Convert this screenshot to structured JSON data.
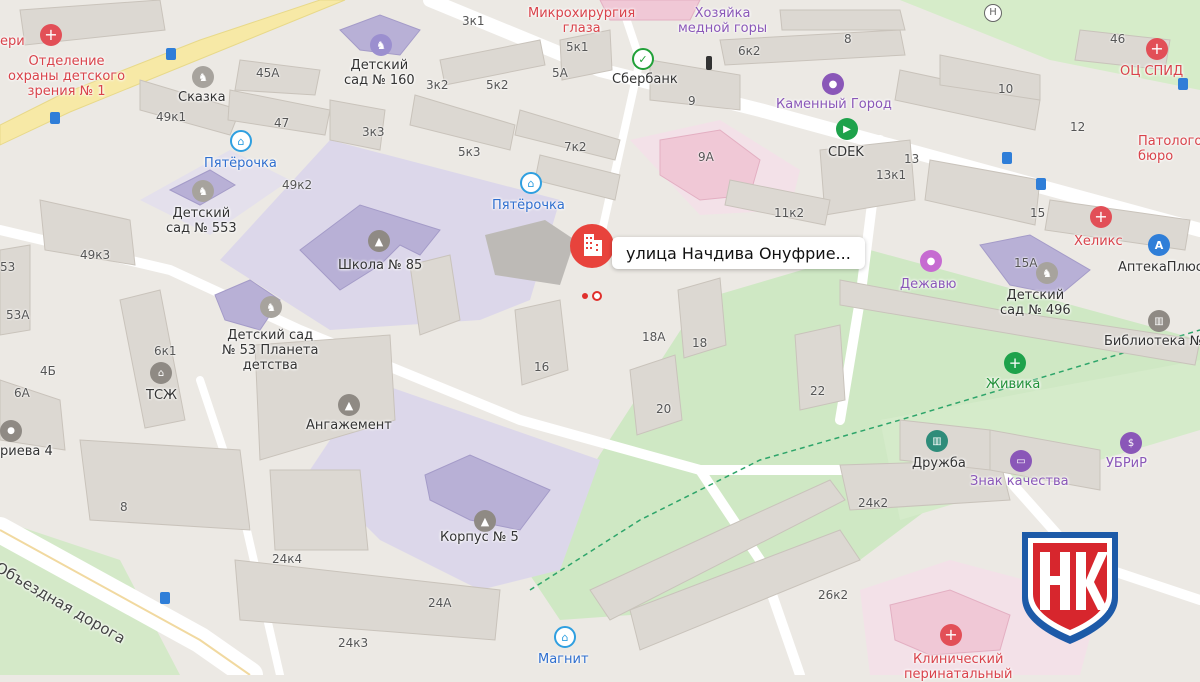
{
  "map": {
    "address_card": "улица Начдива Онуфрие...",
    "roads": [
      "Объездная дорога"
    ],
    "places": {
      "mikro": "Микрохирургия\nглаза",
      "hozyaika": "Хозяйка\nмедной горы",
      "otdelenie": "Отделение\nохраны детского\nзрения № 1",
      "eri": "ери",
      "sad160": "Детский\nсад № 160",
      "sberbank": "Сбербанк",
      "skazka": "Сказка",
      "pyat1": "Пятёрочка",
      "pyat2": "Пятёрочка",
      "kamenny": "Каменный Город",
      "cdek": "CDEK",
      "oc_spid": "ОЦ СПИД",
      "patolog": "Патологоанато\nбюро",
      "sad553": "Детский\nсад № 553",
      "school85": "Школа № 85",
      "helix": "Хеликс",
      "apteka": "АптекаПлюс",
      "dejavu": "Дежавю",
      "sad496": "Детский\nсад № 496",
      "sad53": "Детский сад\n№ 53 Планета\nдетства",
      "biblioteka": "Библиотека №",
      "zhivika": "Живика",
      "tszh": "ТСЖ",
      "angazhement": "Ангажемент",
      "druzhba": "Дружба",
      "ubrir": "УБРиР",
      "znak": "Знак качества",
      "orieva": "риева 4",
      "korpus5": "Корпус № 5",
      "magnit": "Магнит",
      "klinich": "Клинический\nперинатальный"
    },
    "house_numbers": {
      "n3k1": "3к1",
      "n5k1": "5к1",
      "n6k2": "6к2",
      "n8": "8",
      "n46": "46",
      "n45A": "45А",
      "n5A": "5А",
      "n3k2": "3к2",
      "n5k2": "5к2",
      "n9": "9",
      "n10": "10",
      "n49k1": "49к1",
      "n47": "47",
      "n3k3": "3к3",
      "n7k2": "7к2",
      "n9A": "9А",
      "n12": "12",
      "n5k3": "5к3",
      "n13k1": "13к1",
      "n49k2": "49к2",
      "n11k2": "11к2",
      "n15": "15",
      "n49k3": "49к3",
      "n53": "53",
      "n53A": "53А",
      "n15A": "15А",
      "n16": "16",
      "n18A": "18А",
      "n18": "18",
      "n6k1": "6к1",
      "n4B": "4Б",
      "n6A": "6А",
      "n22": "22",
      "n20": "20",
      "n8b": "8",
      "n24k2": "24к2",
      "n24k4": "24к4",
      "n26k2": "26к2",
      "n24A": "24А",
      "n24k3": "24к3",
      "n13": "13"
    },
    "logo_text": "НК",
    "colors": {
      "ground": "#ece9e4",
      "building": "#dcd8d2",
      "building_side": "#cbc6bf",
      "school": "#dcd7ea",
      "school_bldg": "#b8b0d6",
      "park": "#cfe8c4",
      "road": "#ffffff",
      "highway": "#f7e9a6",
      "pin": "#e8433c",
      "logo_red": "#d7262d",
      "logo_blue": "#1d5aa8"
    }
  }
}
